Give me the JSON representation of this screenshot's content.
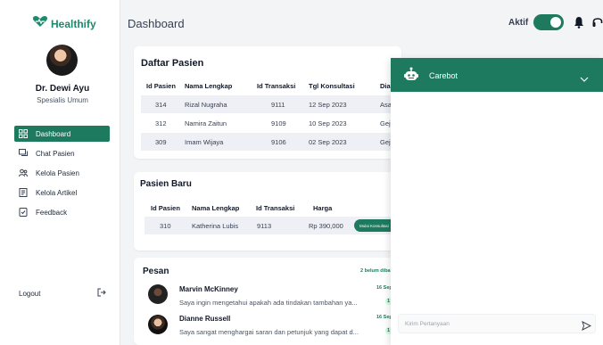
{
  "brand": {
    "name": "Healthify",
    "color": "#1e8a6d",
    "accent": "#1e7a5e"
  },
  "profile": {
    "name": "Dr. Dewi Ayu",
    "role": "Spesialis Umum"
  },
  "sidebar": {
    "items": [
      {
        "label": "Dashboard",
        "icon": "dashboard-icon",
        "active": true
      },
      {
        "label": "Chat Pasien",
        "icon": "chat-icon",
        "active": false
      },
      {
        "label": "Kelola Pasien",
        "icon": "users-icon",
        "active": false
      },
      {
        "label": "Kelola Artikel",
        "icon": "article-icon",
        "active": false
      },
      {
        "label": "Feedback",
        "icon": "feedback-icon",
        "active": false
      }
    ],
    "logout": "Logout"
  },
  "header": {
    "title": "Dashboard",
    "status_label": "Aktif",
    "status_on": true
  },
  "daftar_pasien": {
    "title": "Daftar Pasien",
    "columns": [
      "Id Pasien",
      "Nama Lengkap",
      "Id Transaksi",
      "Tgl Konsultasi",
      "Diag"
    ],
    "rows": [
      [
        "314",
        "Rizal Nugraha",
        "9111",
        "12 Sep 2023",
        "Asa"
      ],
      [
        "312",
        "Namira Zaitun",
        "9109",
        "10 Sep 2023",
        "Gej"
      ],
      [
        "309",
        "Imam Wijaya",
        "9106",
        "02 Sep 2023",
        "Gej"
      ]
    ]
  },
  "pasien_baru": {
    "title": "Pasien Baru",
    "columns": [
      "Id Pasien",
      "Nama Lengkap",
      "Id Transaksi",
      "Harga"
    ],
    "rows": [
      [
        "310",
        "Katherina Lubis",
        "9113",
        "Rp 390,000"
      ]
    ],
    "action_label": "Mulai Konsultasi"
  },
  "pesan": {
    "title": "Pesan",
    "unread": "2 belum diba",
    "messages": [
      {
        "name": "Marvin McKinney",
        "text": "Saya ingin mengetahui apakah ada tindakan tambahan ya...",
        "date": "16 Sep",
        "badge": "1"
      },
      {
        "name": "Dianne Russell",
        "text": "Saya sangat menghargai saran dan petunjuk yang dapat d...",
        "date": "16 Sep",
        "badge": "1"
      }
    ]
  },
  "carebot": {
    "title": "Carebot",
    "placeholder": "Kirim Pertanyaan"
  }
}
